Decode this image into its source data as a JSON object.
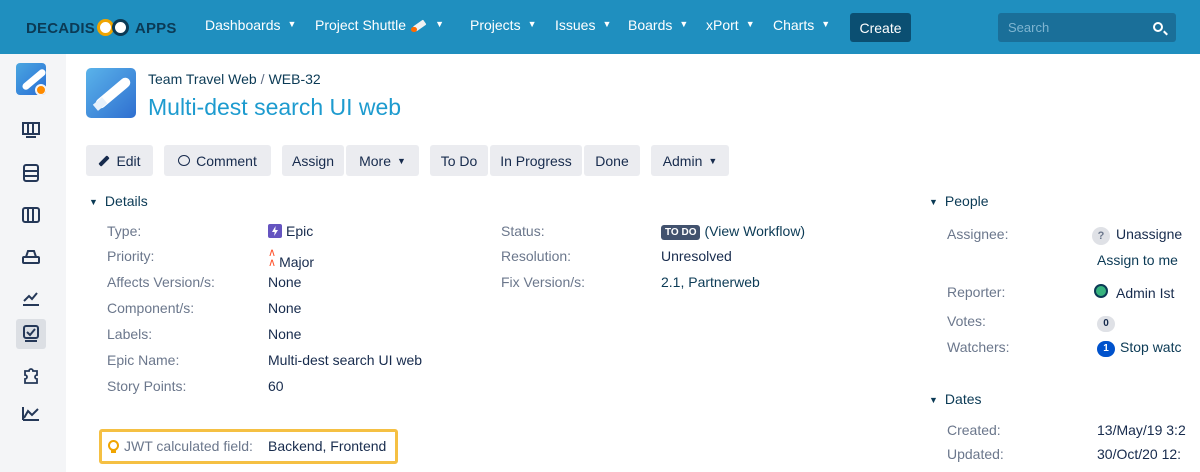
{
  "brand": {
    "part1": "DECADIS",
    "part2": "APPS"
  },
  "topnav": {
    "items": [
      {
        "label": "Dashboards"
      },
      {
        "label": "Project Shuttle"
      },
      {
        "label": "Projects"
      },
      {
        "label": "Issues"
      },
      {
        "label": "Boards"
      },
      {
        "label": "xPort"
      },
      {
        "label": "Charts"
      }
    ],
    "create_label": "Create",
    "search_placeholder": "Search"
  },
  "sidebar": {
    "icons": [
      "project-avatar",
      "board-icon",
      "backlog-icon",
      "columns-icon",
      "releases-icon",
      "reports-icon",
      "issues-icon",
      "addons-icon",
      "chart-icon"
    ],
    "active_index": 6
  },
  "issue": {
    "project": "Team Travel Web",
    "key": "WEB-32",
    "title": "Multi-dest search UI web"
  },
  "toolbar": {
    "edit": "Edit",
    "comment": "Comment",
    "assign": "Assign",
    "more": "More",
    "todo": "To Do",
    "in_progress": "In Progress",
    "done": "Done",
    "admin": "Admin"
  },
  "details": {
    "heading": "Details",
    "type_label": "Type:",
    "type_value": "Epic",
    "priority_label": "Priority:",
    "priority_value": "Major",
    "affects_label": "Affects Version/s:",
    "affects_value": "None",
    "component_label": "Component/s:",
    "component_value": "None",
    "labels_label": "Labels:",
    "labels_value": "None",
    "epic_name_label": "Epic Name:",
    "epic_name_value": "Multi-dest search UI web",
    "story_points_label": "Story Points:",
    "story_points_value": "60",
    "jwt_label": "JWT calculated field:",
    "jwt_value": "Backend, Frontend",
    "status_label": "Status:",
    "status_lozenge": "TO DO",
    "status_link": "(View Workflow)",
    "resolution_label": "Resolution:",
    "resolution_value": "Unresolved",
    "fix_label": "Fix Version/s:",
    "fix_value": "2.1, Partnerweb"
  },
  "people": {
    "heading": "People",
    "assignee_label": "Assignee:",
    "assignee_value": "Unassigne",
    "assign_to_me": "Assign to me",
    "reporter_label": "Reporter:",
    "reporter_value": "Admin Ist",
    "votes_label": "Votes:",
    "votes_value": "0",
    "watchers_label": "Watchers:",
    "watchers_count": "1",
    "watchers_value": "Stop watc"
  },
  "dates": {
    "heading": "Dates",
    "created_label": "Created:",
    "created_value": "13/May/19 3:2",
    "updated_label": "Updated:",
    "updated_value": "30/Oct/20 12:"
  },
  "colors": {
    "topbar": "#1f8fbf",
    "title": "#1d9bcf",
    "highlight_border": "#f5c043",
    "create_button": "#0b4f72"
  }
}
